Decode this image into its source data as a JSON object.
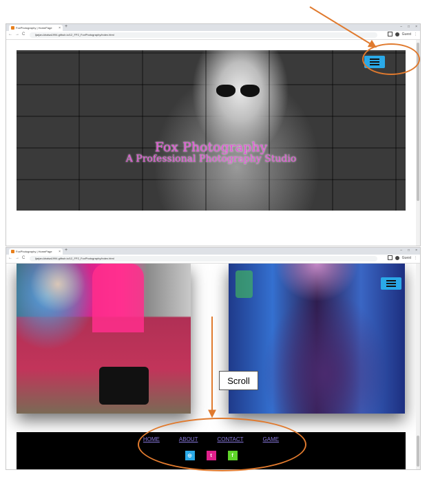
{
  "browser": {
    "tab_title": "FoxPhotography | HomePage",
    "tab_close": "×",
    "new_tab": "+",
    "window_controls": [
      "–",
      "□",
      "×"
    ],
    "nav_icons": [
      "←",
      "→",
      "C"
    ],
    "url": "ljarjan-khalsa1994.github.io/12_FP2_FoxPhotography/index.html",
    "profile_label": "Guest",
    "menu_glyph": "⋮",
    "icon_names": [
      "favicon-icon",
      "back-icon",
      "forward-icon",
      "reload-icon",
      "sidebar-icon",
      "profile-icon",
      "kebab-menu-icon"
    ]
  },
  "hero": {
    "title": "Fox Photography",
    "subtitle": "A Professional Photography Studio"
  },
  "nav_toggle": {
    "icon": "hamburger-menu-icon",
    "color": "#2aa9e8"
  },
  "footer": {
    "links": [
      "HOME",
      "ABOUT",
      "CONTACT",
      "GAME"
    ],
    "socials": [
      {
        "name": "instagram",
        "glyph": "◎",
        "color": "#2aa9e8"
      },
      {
        "name": "twitter",
        "glyph": "t",
        "color": "#e0208c"
      },
      {
        "name": "facebook",
        "glyph": "f",
        "color": "#5fd42a"
      }
    ]
  },
  "annotation": {
    "scroll_label": "Scroll",
    "color": "#e07a2e"
  }
}
